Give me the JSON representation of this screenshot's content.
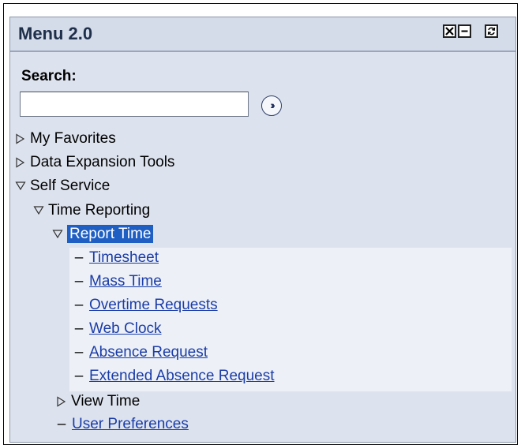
{
  "menu": {
    "title": "Menu 2.0",
    "icons": [
      "close-icon",
      "minimize-icon",
      "refresh-icon"
    ]
  },
  "search": {
    "label": "Search:",
    "value": "",
    "go_icon": "double-chevron-right-icon"
  },
  "tree": {
    "my_favorites": "My Favorites",
    "data_expansion": "Data Expansion Tools",
    "self_service": "Self Service",
    "time_reporting": "Time Reporting",
    "report_time": "Report Time",
    "report_time_items": [
      {
        "label": "Timesheet"
      },
      {
        "label": "Mass Time"
      },
      {
        "label": "Overtime Requests"
      },
      {
        "label": "Web Clock"
      },
      {
        "label": "Absence Request"
      },
      {
        "label": "Extended Absence Request"
      }
    ],
    "view_time": "View Time",
    "user_preferences": "User Preferences"
  },
  "colors": {
    "panel_bg": "#dde3ee",
    "link": "#1b3ca8",
    "selected_bg": "#1f5ec3"
  }
}
